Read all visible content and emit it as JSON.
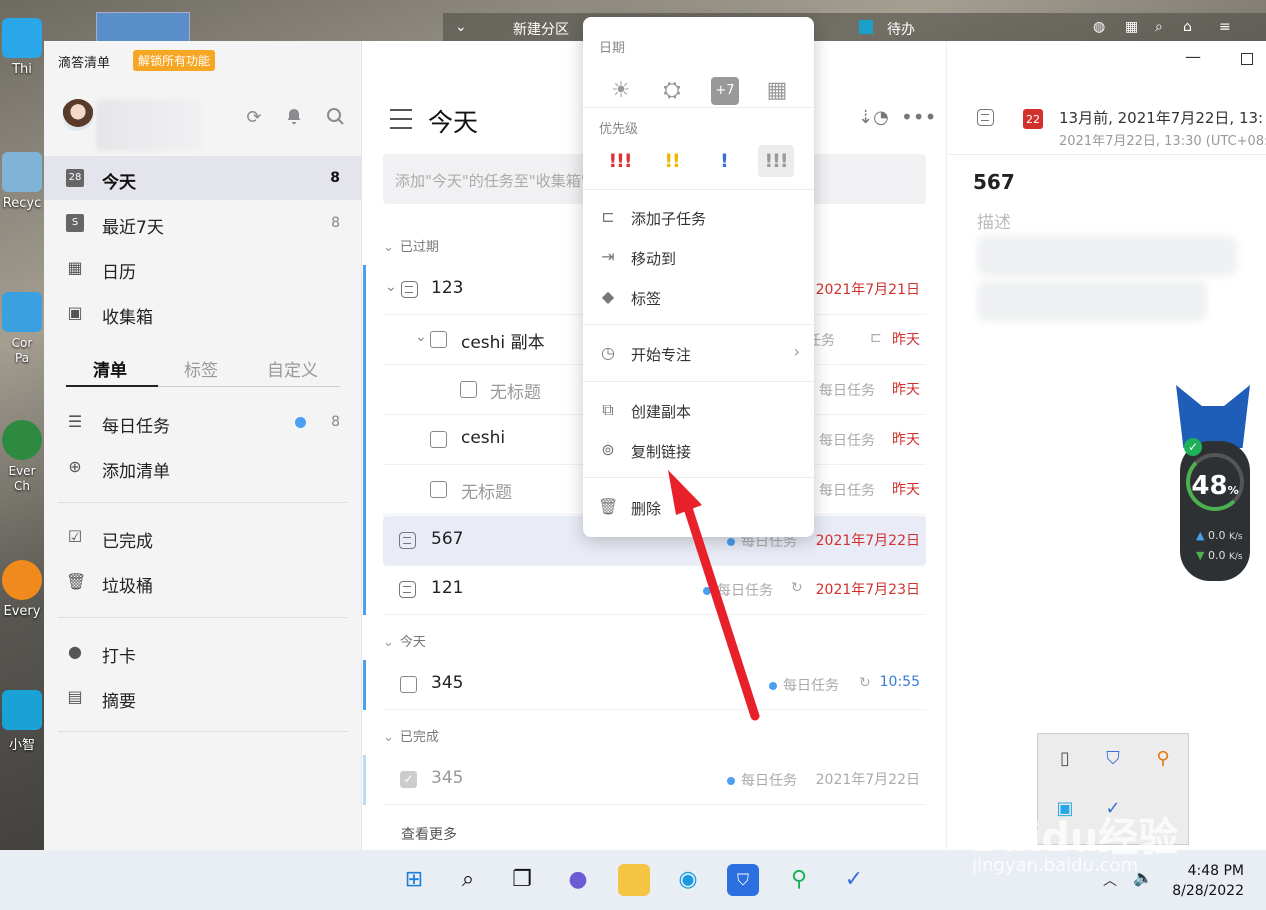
{
  "desktop": {
    "icons": [
      {
        "label": "Thi",
        "icon": "monitor-icon"
      },
      {
        "label": "Recyc",
        "icon": "recycle-bin-icon"
      },
      {
        "label": "Cor\nPa",
        "icon": "control-panel-icon"
      },
      {
        "label": "Ever\nCh",
        "icon": "everything-icon"
      },
      {
        "label": "Every",
        "icon": "everything-search-icon"
      },
      {
        "label": "小智",
        "icon": "pc-icon"
      }
    ],
    "top_strip": {
      "partition": "新建分区",
      "todo": "待办"
    }
  },
  "sidebar": {
    "brand": "滴答清单",
    "unlock_badge": "解锁所有功能",
    "nav": [
      {
        "label": "今天",
        "count": "8",
        "icon": "calendar-28-icon"
      },
      {
        "label": "最近7天",
        "count": "8",
        "icon": "calendar-7-icon"
      },
      {
        "label": "日历",
        "count": "",
        "icon": "calendar-grid-icon"
      },
      {
        "label": "收集箱",
        "count": "",
        "icon": "inbox-icon"
      }
    ],
    "segments": [
      "清单",
      "标签",
      "自定义"
    ],
    "lists": [
      {
        "label": "每日任务",
        "count": "8",
        "icon": "list-icon"
      },
      {
        "label": "添加清单",
        "count": "",
        "icon": "add-circle-icon"
      }
    ],
    "system": [
      {
        "label": "已完成",
        "icon": "checkbox-icon"
      },
      {
        "label": "垃圾桶",
        "icon": "trash-icon"
      }
    ],
    "extras": [
      {
        "label": "打卡",
        "icon": "checkin-pin-icon"
      },
      {
        "label": "摘要",
        "icon": "summary-icon"
      }
    ]
  },
  "main": {
    "title": "今天",
    "quick_add_placeholder": "添加\"今天\"的任务至\"收集箱\"",
    "sections": {
      "overdue": "已过期",
      "today": "今天",
      "completed": "已完成"
    },
    "rows": [
      {
        "title": "123",
        "list": "",
        "date": "2021年7月21日"
      },
      {
        "title": "ceshi  副本",
        "list": "任务",
        "date": "昨天"
      },
      {
        "title": "无标题",
        "list": "每日任务",
        "date": "昨天"
      },
      {
        "title": "ceshi",
        "list": "每日任务",
        "date": "昨天"
      },
      {
        "title": "无标题",
        "list": "每日任务",
        "date": "昨天"
      },
      {
        "title": "567",
        "list": "每日任务",
        "date": "2021年7月22日"
      },
      {
        "title": "121",
        "list": "每日任务",
        "date": "2021年7月23日"
      },
      {
        "title": "345",
        "list": "每日任务",
        "date": "10:55"
      },
      {
        "title": "345",
        "list": "每日任务",
        "date": "2021年7月22日"
      }
    ],
    "view_more": "查看更多"
  },
  "context_menu": {
    "date_header": "日期",
    "date_options": [
      "today-sun-icon",
      "tomorrow-sunrise-icon",
      "plus7-icon",
      "calendar-pick-icon"
    ],
    "plus7": "+7",
    "priority_header": "优先级",
    "priorities": [
      {
        "mark": "!!!",
        "color": "#e03131"
      },
      {
        "mark": "!!",
        "color": "#f2b705"
      },
      {
        "mark": "!",
        "color": "#3a6fd8"
      },
      {
        "mark": "!!!",
        "color": "#999999"
      }
    ],
    "items": [
      {
        "label": "添加子任务",
        "icon": "subtask-icon"
      },
      {
        "label": "移动到",
        "icon": "move-icon"
      },
      {
        "label": "标签",
        "icon": "tag-icon"
      },
      {
        "label": "开始专注",
        "icon": "focus-timer-icon"
      },
      {
        "label": "创建副本",
        "icon": "duplicate-icon"
      },
      {
        "label": "复制链接",
        "icon": "link-icon"
      },
      {
        "label": "删除",
        "icon": "trash-icon"
      }
    ]
  },
  "detail": {
    "cal_day": "22",
    "date_line1": "13月前, 2021年7月22日, 13:",
    "date_line2": "2021年7月22日, 13:30 (UTC+08:",
    "title": "567",
    "desc_placeholder": "描述"
  },
  "widget": {
    "percent": "48",
    "percent_unit": "%",
    "up": "0.0",
    "down": "0.0",
    "unit": "K/s"
  },
  "taskbar": {
    "time": "4:48 PM",
    "date": "8/28/2022"
  },
  "watermark": {
    "text": "Baidu经验",
    "url": "jingyan.baidu.com"
  },
  "colors": {
    "accent": "#4a9ff0",
    "overdue": "#d0312d",
    "unlock": "#f6a623",
    "arrow": "#e8202a"
  }
}
